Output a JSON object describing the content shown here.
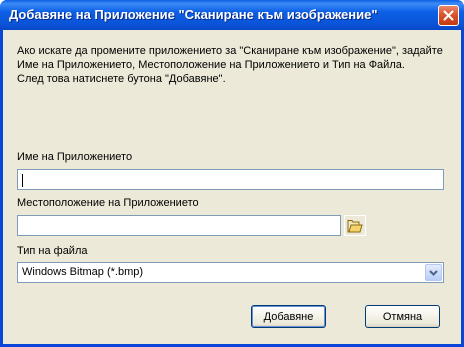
{
  "window": {
    "title": "Добавяне на Приложение \"Сканиране към изображение\""
  },
  "intro": {
    "line1": "Ако искате да промените приложението за \"Сканиране към изображение\", задайте",
    "line2": "Име на Приложението, Местоположение на Приложението и Тип на Файла.",
    "line3": "След това натиснете бутона \"Добавяне\"."
  },
  "app_name": {
    "label": "Име на Приложението",
    "value": ""
  },
  "app_location": {
    "label": "Местоположение на Приложението",
    "value": ""
  },
  "file_type": {
    "label": "Тип на файла",
    "selected": "Windows Bitmap (*.bmp)"
  },
  "buttons": {
    "add": "Добавяне",
    "cancel": "Отмяна"
  },
  "icons": {
    "close": "close-icon",
    "browse": "folder-icon",
    "dropdown": "chevron-down-icon"
  }
}
